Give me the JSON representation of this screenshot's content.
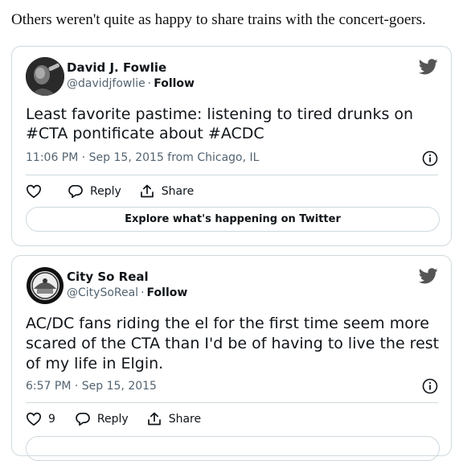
{
  "intro_text": "Others weren't quite as happy to share trains with the concert-goers.",
  "colors": {
    "text": "#0f1419",
    "muted": "#536471",
    "border": "#cfd9de"
  },
  "tweets": [
    {
      "author_name": "David J. Fowlie",
      "handle": "@davidjfowlie",
      "separator": "·",
      "follow_label": "Follow",
      "text": "Least favorite pastime: listening to tired drunks on #CTA pontificate about #ACDC",
      "timestamp": "11:06 PM · Sep 15, 2015 from Chicago, IL",
      "like_count": "",
      "reply_label": "Reply",
      "share_label": "Share",
      "explore_label": "Explore what's happening on Twitter",
      "avatar_icon": "person-photo-icon"
    },
    {
      "author_name": "City So Real",
      "handle": "@CitySoReal",
      "separator": "·",
      "follow_label": "Follow",
      "text": "AC/DC fans riding the el for the first time seem more scared of the CTA than I'd be of having to live the rest of my life in Elgin.",
      "timestamp": "6:57 PM · Sep 15, 2015",
      "like_count": "9",
      "reply_label": "Reply",
      "share_label": "Share",
      "explore_label": "",
      "avatar_icon": "city-seal-icon"
    }
  ]
}
